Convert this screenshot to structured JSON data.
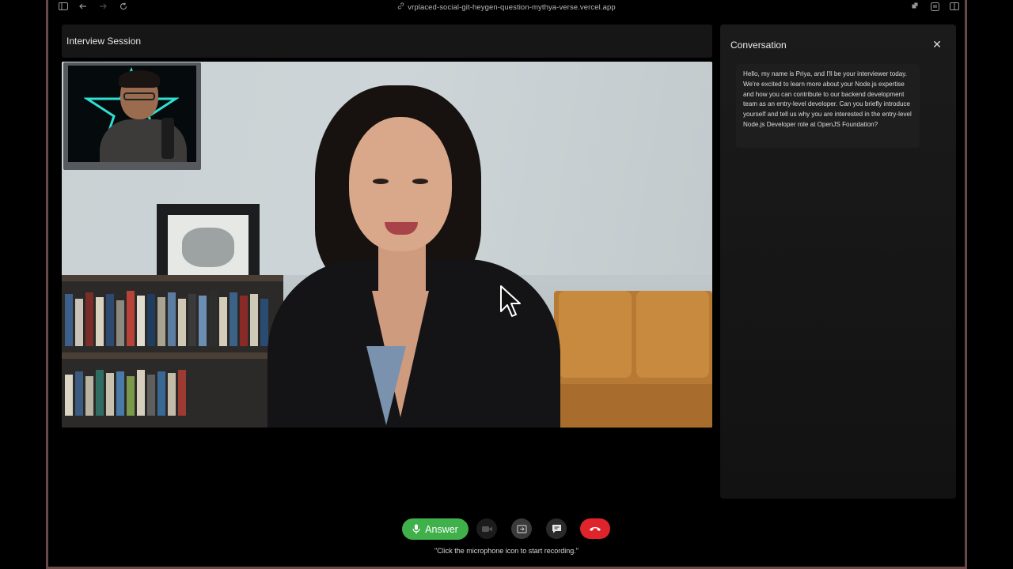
{
  "browser": {
    "url": "vrplaced-social-git-heygen-question-mythya-verse.vercel.app"
  },
  "session": {
    "title": "Interview Session"
  },
  "conversation": {
    "title": "Conversation",
    "messages": [
      {
        "text": "Hello, my name is Priya, and I'll be your interviewer today. We're excited to learn more about your Node.js expertise and how you can contribute to our backend development team as an entry-level developer. Can you briefly introduce yourself and tell us why you are interested in the entry-level Node.js Developer role at OpenJS Foundation?"
      }
    ]
  },
  "controls": {
    "answer_label": "Answer",
    "hint": "\"Click the microphone icon to start recording.\""
  },
  "colors": {
    "answer_green": "#3fb04a",
    "end_call_red": "#e0242b",
    "window_border": "#6b4848"
  }
}
